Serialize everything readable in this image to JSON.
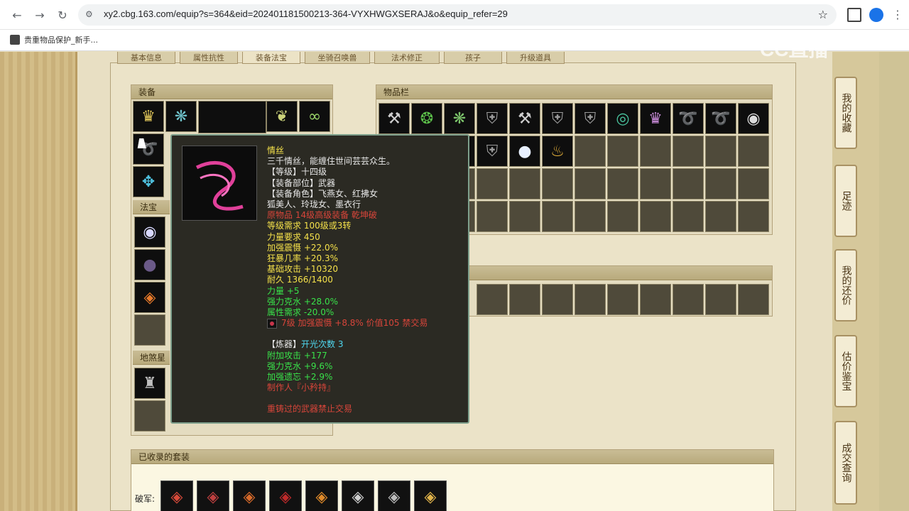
{
  "browser": {
    "url": "xy2.cbg.163.com/equip?s=364&eid=202401181500213-364-VYXHWGXSERAJ&o&equip_refer=29",
    "bookmark": "贵重物品保护_新手..."
  },
  "watermark": "CC直播",
  "tabs": [
    "基本信息",
    "属性抗性",
    "装备法宝",
    "坐骑召唤兽",
    "法术修正",
    "孩子",
    "升级道具"
  ],
  "sections": {
    "equipment": "装备",
    "fabao": "法宝",
    "disha": "地煞星",
    "inventory": "物品栏",
    "collected_suits": "已收录的套装"
  },
  "suit_label": "破军:",
  "side_nav": [
    "我的收藏",
    "足迹",
    "我的还价",
    "估价鉴宝",
    "成交查询"
  ],
  "tooltip": {
    "name": "情丝",
    "desc": "三千情丝，能缠住世间芸芸众生。",
    "level": "【等级】十四级",
    "part": "【装备部位】武器",
    "roles_1": "【装备角色】飞燕女、红拂女",
    "roles_2": "狐美人、玲珑女、墨衣行",
    "origin": "原物品 14级高级装备 乾坤破",
    "req_level": "等级需求 100级或3转",
    "req_str": "力量要求 450",
    "stat_1": "加强震慑 +22.0%",
    "stat_2": "狂暴几率 +20.3%",
    "stat_3": "基础攻击 +10320",
    "stat_4": "耐久 1366/1400",
    "stat_5": "力量 +5",
    "stat_6": "强力克水 +28.0%",
    "stat_7": "属性需求 -20.0%",
    "gem_line": "7级 加强震慑 +8.8% 价值105 禁交易",
    "refine_label": "【炼器】",
    "refine_count": "开光次数 3",
    "refine_1": "附加攻击 +177",
    "refine_2": "强力克水 +9.6%",
    "refine_3": "加强遗忘 +2.9%",
    "maker": "制作人『小矜持』",
    "note": "重铸过的武器禁止交易"
  }
}
